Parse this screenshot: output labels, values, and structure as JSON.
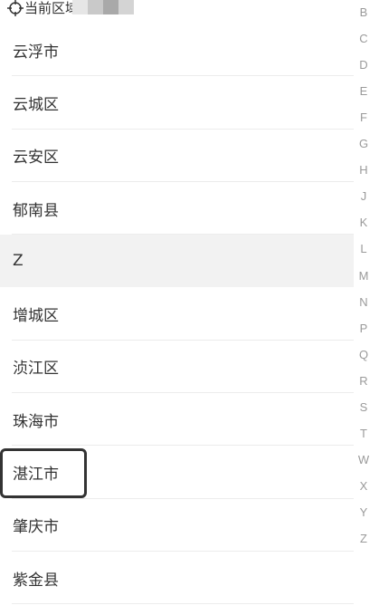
{
  "current_location": {
    "icon": "locate-icon",
    "label": "当前区域"
  },
  "list": {
    "rows": [
      {
        "type": "city",
        "label": "云浮市"
      },
      {
        "type": "city",
        "label": "云城区"
      },
      {
        "type": "city",
        "label": "云安区"
      },
      {
        "type": "city",
        "label": "郁南县"
      },
      {
        "type": "header",
        "label": "Z"
      },
      {
        "type": "city",
        "label": "增城区"
      },
      {
        "type": "city",
        "label": "浈江区"
      },
      {
        "type": "city",
        "label": "珠海市"
      },
      {
        "type": "city",
        "label": "湛江市"
      },
      {
        "type": "city",
        "label": "肇庆市"
      },
      {
        "type": "city",
        "label": "紫金县"
      }
    ]
  },
  "index_bar": {
    "letters": [
      "B",
      "C",
      "D",
      "E",
      "F",
      "G",
      "H",
      "J",
      "K",
      "L",
      "M",
      "N",
      "P",
      "Q",
      "R",
      "S",
      "T",
      "W",
      "X",
      "Y",
      "Z"
    ]
  },
  "colors": {
    "text": "#333333",
    "index_text": "#9a9a9a",
    "header_bg": "#f2f2f2",
    "divider": "#ececec",
    "highlight_border": "#333333"
  }
}
